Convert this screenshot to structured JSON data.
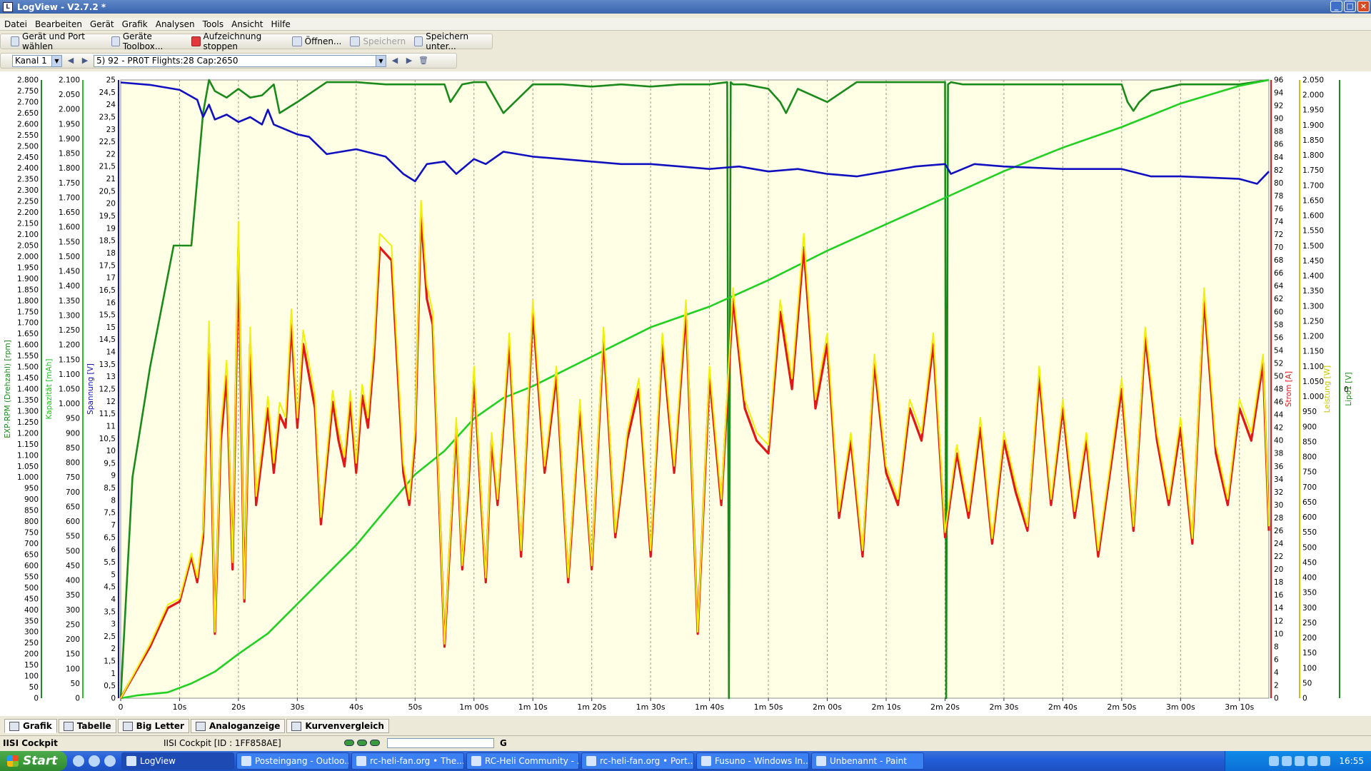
{
  "window": {
    "title": "LogView - V2.7.2 *",
    "app_icon": "logview-icon"
  },
  "menu": [
    "Datei",
    "Bearbeiten",
    "Gerät",
    "Grafik",
    "Analysen",
    "Tools",
    "Ansicht",
    "Hilfe"
  ],
  "toolbar": {
    "port": "Gerät und Port wählen",
    "toolbox": "Geräte Toolbox...",
    "stop": "Aufzeichnung stoppen",
    "open": "Öffnen...",
    "save": "Speichern",
    "save_as": "Speichern unter..."
  },
  "toolbar2": {
    "channel": "Kanal 1",
    "session": "5) 92 - PR0T  Flights:28  Cap:2650"
  },
  "tabs": [
    "Grafik",
    "Tabelle",
    "Big Letter",
    "Analoganzeige",
    "Kurvenvergleich"
  ],
  "status": {
    "device": "IISI Cockpit",
    "device_id": "IISI Cockpit [ID : 1FF858AE]",
    "leds": [
      "CON",
      "RX",
      "TX"
    ],
    "gauge_label": "G"
  },
  "taskbar": {
    "start": "Start",
    "tasks": [
      "LogView",
      "Posteingang - Outloo...",
      "rc-heli-fan.org • The...",
      "RC-Heli Community - ...",
      "rc-heli-fan.org • Port...",
      "Fusuno - Windows In...",
      "Unbenannt - Paint"
    ],
    "clock": "16:55"
  },
  "chart_data": {
    "type": "line",
    "x_unit": "time",
    "x_ticks": [
      "0",
      "10s",
      "20s",
      "30s",
      "40s",
      "50s",
      "1m 00s",
      "1m 10s",
      "1m 20s",
      "1m 30s",
      "1m 40s",
      "1m 50s",
      "2m 00s",
      "2m 10s",
      "2m 20s",
      "2m 30s",
      "2m 40s",
      "2m 50s",
      "3m 00s",
      "3m 10s"
    ],
    "xlim": [
      0,
      195
    ],
    "axes": [
      {
        "label": "EXP-RPM (Drehzahl) [rpm]",
        "min": 0,
        "max": 2800,
        "step": 50,
        "color": "#1c8a1c"
      },
      {
        "label": "Kapazität [mAh]",
        "min": 0,
        "max": 2100,
        "step": 50,
        "color": "#22c422"
      },
      {
        "label": "Spannung [V]",
        "min": 0,
        "max": 25,
        "step": 0.5,
        "color": "#1010b0"
      },
      {
        "label": "Strom [A]",
        "min": 0,
        "max": 96,
        "step": 2,
        "color": "#e01818"
      },
      {
        "label": "Leistung [W]",
        "min": 0,
        "max": 2050,
        "step": 50,
        "color": "#c8c800"
      },
      {
        "label": "Lipo1 [V]",
        "min": 0,
        "max": 0,
        "step": 0,
        "color": "#1c8a1c"
      }
    ],
    "series": [
      {
        "name": "EXP-RPM (Drehzahl) [rpm]",
        "color": "#1a8a1a",
        "x": [
          0,
          2,
          5,
          9,
          10,
          12,
          14,
          15,
          16,
          18,
          20,
          22,
          24,
          26,
          27,
          30,
          35,
          40,
          45,
          50,
          55,
          56,
          58,
          60,
          62,
          65,
          70,
          75,
          80,
          85,
          90,
          95,
          100,
          103,
          103.3,
          103.6,
          104,
          106,
          110,
          112,
          113,
          115,
          120,
          125,
          130,
          135,
          138,
          140,
          140.2,
          140.5,
          141,
          143,
          145,
          150,
          160,
          170,
          171,
          172,
          173,
          175,
          180,
          185,
          190,
          195
        ],
        "y": [
          0,
          1000,
          1500,
          2050,
          2050,
          2050,
          2650,
          2800,
          2750,
          2720,
          2760,
          2720,
          2730,
          2780,
          2650,
          2700,
          2790,
          2790,
          2780,
          2780,
          2780,
          2700,
          2780,
          2790,
          2790,
          2650,
          2780,
          2780,
          2770,
          2780,
          2770,
          2780,
          2780,
          2790,
          0,
          2790,
          2780,
          2780,
          2760,
          2700,
          2650,
          2760,
          2700,
          2790,
          2790,
          2790,
          2790,
          2790,
          0,
          2780,
          2790,
          2780,
          2780,
          2780,
          2780,
          2780,
          2700,
          2660,
          2700,
          2750,
          2780,
          2780,
          2780,
          2800
        ]
      },
      {
        "name": "Kapazität [mAh]",
        "color": "#22d022",
        "x": [
          0,
          3,
          8,
          12,
          16,
          20,
          25,
          30,
          40,
          50,
          55,
          60,
          65,
          70,
          80,
          90,
          100,
          110,
          120,
          130,
          140,
          150,
          160,
          170,
          180,
          190,
          195
        ],
        "y": [
          0,
          10,
          20,
          50,
          90,
          150,
          220,
          320,
          520,
          760,
          840,
          950,
          1020,
          1060,
          1160,
          1260,
          1330,
          1420,
          1520,
          1610,
          1700,
          1790,
          1870,
          1940,
          2020,
          2080,
          2100
        ]
      },
      {
        "name": "Spannung [V]",
        "color": "#1010c0",
        "x": [
          0,
          5,
          10,
          13,
          14,
          15,
          16,
          18,
          20,
          22,
          24,
          25,
          26,
          30,
          32,
          35,
          40,
          45,
          48,
          50,
          52,
          55,
          57,
          60,
          62,
          65,
          70,
          75,
          80,
          85,
          90,
          95,
          100,
          105,
          110,
          115,
          120,
          125,
          130,
          135,
          140,
          141,
          145,
          150,
          160,
          170,
          175,
          180,
          190,
          193,
          195
        ],
        "y": [
          24.9,
          24.8,
          24.6,
          24.2,
          23.5,
          24.0,
          23.4,
          23.6,
          23.3,
          23.5,
          23.2,
          23.8,
          23.2,
          22.8,
          22.7,
          22.0,
          22.2,
          21.9,
          21.2,
          20.9,
          21.6,
          21.7,
          21.2,
          21.8,
          21.6,
          22.1,
          21.9,
          21.8,
          21.7,
          21.6,
          21.6,
          21.5,
          21.4,
          21.5,
          21.3,
          21.4,
          21.2,
          21.1,
          21.3,
          21.5,
          21.6,
          21.2,
          21.6,
          21.5,
          21.4,
          21.4,
          21.1,
          21.1,
          21.0,
          20.8,
          21.3
        ]
      },
      {
        "name": "Strom [A]",
        "color": "#e01818",
        "x": [
          0,
          5,
          8,
          10,
          12,
          13,
          14,
          15,
          16,
          17,
          18,
          19,
          20,
          21,
          22,
          23,
          25,
          26,
          27,
          28,
          29,
          30,
          31,
          32,
          33,
          34,
          36,
          37,
          38,
          39,
          40,
          41,
          42,
          43,
          44,
          46,
          48,
          49,
          50,
          51,
          52,
          53,
          55,
          57,
          58,
          59,
          60,
          62,
          63,
          64,
          66,
          68,
          70,
          72,
          74,
          76,
          78,
          80,
          82,
          84,
          86,
          88,
          90,
          92,
          94,
          96,
          98,
          100,
          102,
          104,
          106,
          108,
          110,
          112,
          114,
          116,
          118,
          120,
          122,
          124,
          126,
          128,
          130,
          132,
          134,
          136,
          138,
          140,
          142,
          144,
          146,
          148,
          150,
          152,
          154,
          156,
          158,
          160,
          162,
          164,
          166,
          168,
          170,
          172,
          174,
          176,
          178,
          180,
          182,
          184,
          186,
          188,
          190,
          192,
          194,
          195
        ],
        "y": [
          0,
          8,
          14,
          15,
          22,
          18,
          25,
          55,
          10,
          40,
          50,
          20,
          70,
          15,
          55,
          30,
          45,
          35,
          44,
          42,
          58,
          42,
          55,
          50,
          45,
          27,
          46,
          40,
          36,
          46,
          35,
          47,
          42,
          53,
          70,
          68,
          35,
          30,
          40,
          75,
          62,
          58,
          8,
          42,
          20,
          32,
          50,
          18,
          40,
          30,
          55,
          22,
          60,
          35,
          50,
          18,
          45,
          20,
          56,
          25,
          40,
          48,
          22,
          55,
          35,
          60,
          10,
          50,
          30,
          62,
          45,
          40,
          38,
          60,
          48,
          70,
          45,
          55,
          28,
          40,
          22,
          52,
          35,
          30,
          45,
          40,
          55,
          25,
          38,
          28,
          42,
          24,
          40,
          32,
          26,
          50,
          30,
          45,
          28,
          40,
          22,
          35,
          48,
          26,
          56,
          40,
          30,
          42,
          24,
          62,
          38,
          30,
          45,
          40,
          52,
          26
        ]
      },
      {
        "name": "Leistung [W]",
        "color": "#f0f000",
        "x": [
          0,
          5,
          8,
          10,
          12,
          13,
          14,
          15,
          16,
          17,
          18,
          19,
          20,
          21,
          22,
          23,
          25,
          26,
          27,
          28,
          29,
          30,
          31,
          32,
          33,
          34,
          36,
          37,
          38,
          39,
          40,
          41,
          42,
          43,
          44,
          46,
          48,
          49,
          50,
          51,
          52,
          53,
          55,
          57,
          58,
          59,
          60,
          62,
          63,
          64,
          66,
          68,
          70,
          72,
          74,
          76,
          78,
          80,
          82,
          84,
          86,
          88,
          90,
          92,
          94,
          96,
          98,
          100,
          102,
          104,
          106,
          108,
          110,
          112,
          114,
          116,
          118,
          120,
          122,
          124,
          126,
          128,
          130,
          132,
          134,
          136,
          138,
          140,
          142,
          144,
          146,
          148,
          150,
          152,
          154,
          156,
          158,
          160,
          162,
          164,
          166,
          168,
          170,
          172,
          174,
          176,
          178,
          180,
          182,
          184,
          186,
          188,
          190,
          192,
          194,
          195
        ],
        "y": [
          0,
          180,
          310,
          330,
          480,
          400,
          560,
          1250,
          220,
          900,
          1120,
          450,
          1580,
          330,
          1230,
          670,
          1000,
          780,
          980,
          930,
          1290,
          930,
          1220,
          1110,
          1000,
          600,
          1020,
          890,
          800,
          1020,
          780,
          1040,
          930,
          1170,
          1540,
          1500,
          780,
          660,
          890,
          1650,
          1370,
          1280,
          180,
          930,
          440,
          710,
          1100,
          400,
          880,
          660,
          1210,
          490,
          1320,
          770,
          1100,
          400,
          990,
          440,
          1230,
          550,
          880,
          1060,
          490,
          1210,
          770,
          1320,
          220,
          1100,
          660,
          1360,
          990,
          880,
          840,
          1320,
          1060,
          1540,
          990,
          1210,
          620,
          880,
          490,
          1140,
          770,
          660,
          990,
          880,
          1210,
          550,
          840,
          620,
          930,
          530,
          880,
          710,
          570,
          1100,
          660,
          990,
          620,
          880,
          490,
          770,
          1060,
          570,
          1230,
          880,
          660,
          930,
          530,
          1360,
          840,
          660,
          990,
          880,
          1140,
          570
        ]
      }
    ]
  }
}
